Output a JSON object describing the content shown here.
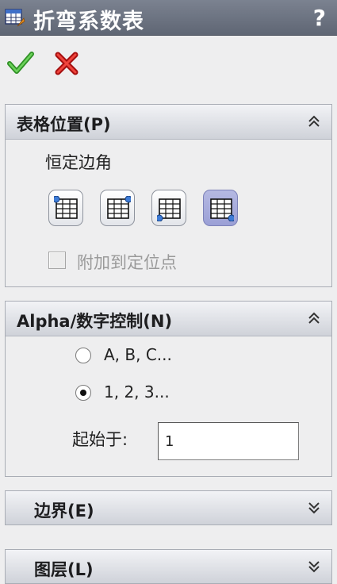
{
  "window": {
    "title": "折弯系数表",
    "help": "?"
  },
  "actions": {
    "ok_icon": "green-checkmark-icon",
    "cancel_icon": "red-x-icon"
  },
  "table_position": {
    "header": "表格位置(P)",
    "anchor_label": "恒定边角",
    "attach_label": "附加到定位点",
    "attach_checked": false,
    "attach_enabled": false,
    "corners": [
      "top-left",
      "top-right",
      "bottom-left",
      "bottom-right"
    ],
    "selected_corner": "bottom-right"
  },
  "alpha_numeric": {
    "header": "Alpha/数字控制(N)",
    "option_alpha": "A, B, C...",
    "option_numeric": "1, 2, 3...",
    "selected": "numeric",
    "start_label": "起始于:",
    "start_value": "1"
  },
  "border": {
    "header": "边界(E)"
  },
  "layer": {
    "header": "图层(L)"
  },
  "colors": {
    "titlebar": "#6a7180",
    "selected_button": "#a9aedc",
    "accent_green": "#3aa12f",
    "accent_red": "#d01818"
  }
}
